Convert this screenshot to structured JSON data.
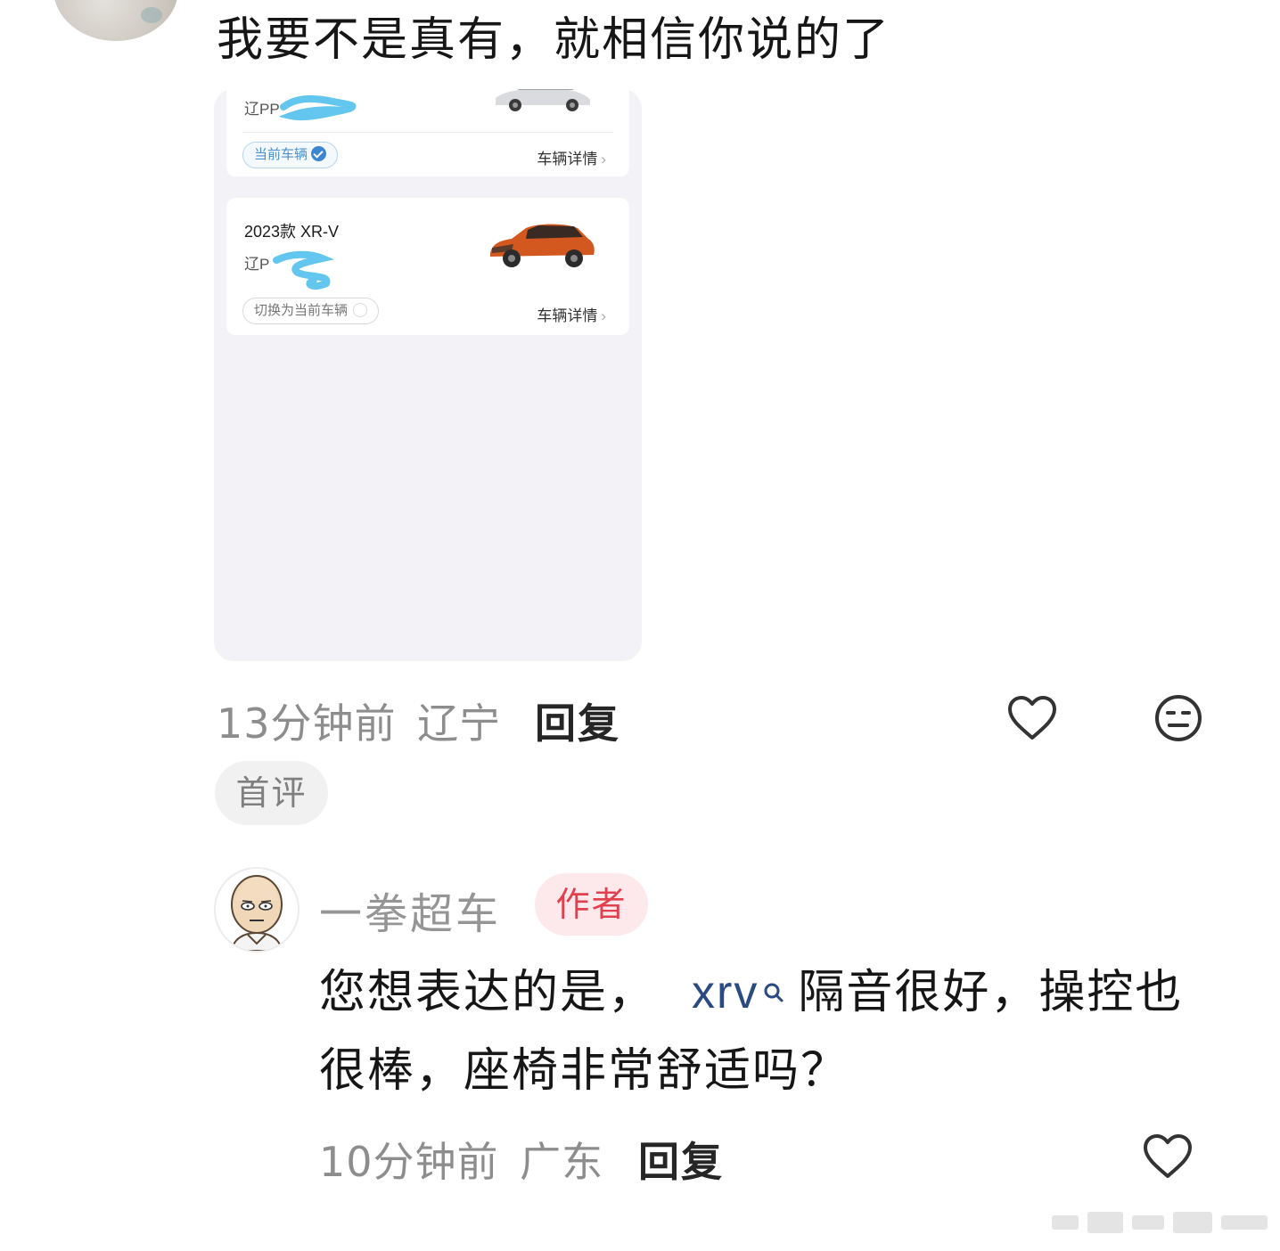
{
  "top_comment": {
    "text": "我要不是真有，就相信你说的了",
    "time": "13分钟前",
    "location": "辽宁",
    "reply_label": "回复",
    "badge": "首评"
  },
  "screenshot": {
    "vehicle1": {
      "plate": "辽PP",
      "current_label": "当前车辆",
      "detail_label": "车辆详情"
    },
    "vehicle2": {
      "model": "2023款 XR-V",
      "plate": "辽P",
      "switch_label": "切换为当前车辆",
      "detail_label": "车辆详情"
    }
  },
  "reply_comment": {
    "author": "一拳超车",
    "author_badge": "作者",
    "text_before": "您想表达的是，",
    "keyword": "xrv",
    "text_after": "隔音很好，操控也很棒，座椅非常舒适吗？",
    "time": "10分钟前",
    "location": "广东",
    "reply_label": "回复"
  },
  "icons": {
    "like": "heart-icon",
    "dislike": "meh-face-icon",
    "keyword_search": "search-icon",
    "chevron": "chevron-right-icon",
    "check": "check-circle-icon"
  },
  "colors": {
    "author_badge_bg": "#fde9ec",
    "author_badge_text": "#e2404f",
    "keyword": "#2a4a82",
    "current_pill": "#4a8fcf",
    "car_orange": "#d2581f"
  }
}
